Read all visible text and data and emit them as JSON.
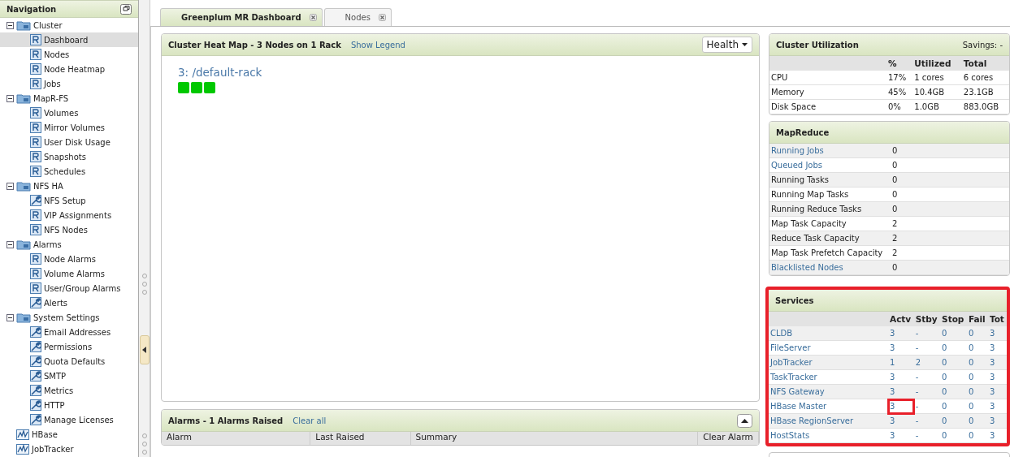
{
  "navigation": {
    "title": "Navigation",
    "groups": [
      {
        "label": "Cluster",
        "expanded": true,
        "children": [
          {
            "label": "Dashboard",
            "kind": "report",
            "selected": true
          },
          {
            "label": "Nodes",
            "kind": "report",
            "selected": false
          },
          {
            "label": "Node Heatmap",
            "kind": "report",
            "selected": false
          },
          {
            "label": "Jobs",
            "kind": "report",
            "selected": false
          }
        ]
      },
      {
        "label": "MapR-FS",
        "expanded": true,
        "children": [
          {
            "label": "Volumes",
            "kind": "report",
            "selected": false
          },
          {
            "label": "Mirror Volumes",
            "kind": "report",
            "selected": false
          },
          {
            "label": "User Disk Usage",
            "kind": "report",
            "selected": false
          },
          {
            "label": "Snapshots",
            "kind": "report",
            "selected": false
          },
          {
            "label": "Schedules",
            "kind": "report",
            "selected": false
          }
        ]
      },
      {
        "label": "NFS HA",
        "expanded": true,
        "children": [
          {
            "label": "NFS Setup",
            "kind": "tool",
            "selected": false
          },
          {
            "label": "VIP Assignments",
            "kind": "report",
            "selected": false
          },
          {
            "label": "NFS Nodes",
            "kind": "report",
            "selected": false
          }
        ]
      },
      {
        "label": "Alarms",
        "expanded": true,
        "children": [
          {
            "label": "Node Alarms",
            "kind": "report",
            "selected": false
          },
          {
            "label": "Volume Alarms",
            "kind": "report",
            "selected": false
          },
          {
            "label": "User/Group Alarms",
            "kind": "report",
            "selected": false
          },
          {
            "label": "Alerts",
            "kind": "tool",
            "selected": false
          }
        ]
      },
      {
        "label": "System Settings",
        "expanded": true,
        "children": [
          {
            "label": "Email Addresses",
            "kind": "tool",
            "selected": false
          },
          {
            "label": "Permissions",
            "kind": "tool",
            "selected": false
          },
          {
            "label": "Quota Defaults",
            "kind": "tool",
            "selected": false
          },
          {
            "label": "SMTP",
            "kind": "tool",
            "selected": false
          },
          {
            "label": "Metrics",
            "kind": "tool",
            "selected": false
          },
          {
            "label": "HTTP",
            "kind": "tool",
            "selected": false
          },
          {
            "label": "Manage Licenses",
            "kind": "tool",
            "selected": false
          }
        ]
      }
    ],
    "links": [
      {
        "label": "HBase"
      },
      {
        "label": "JobTracker"
      }
    ]
  },
  "tabs": [
    {
      "label": "Greenplum MR Dashboard",
      "selected": true
    },
    {
      "label": "Nodes",
      "selected": false
    }
  ],
  "heatmap": {
    "title": "Cluster Heat Map - 3 Nodes on 1 Rack",
    "legend_link": "Show Legend",
    "dropdown": "Health",
    "rack": "3: /default-rack",
    "nodes": [
      {
        "color": "#00c800"
      },
      {
        "color": "#00c800"
      },
      {
        "color": "#00c800"
      }
    ]
  },
  "alarms": {
    "title": "Alarms - 1 Alarms Raised",
    "clear_link": "Clear all",
    "columns": [
      "Alarm",
      "Last Raised",
      "Summary",
      "Clear Alarm"
    ]
  },
  "utilization": {
    "title": "Cluster Utilization",
    "savings": "Savings: -",
    "columns": [
      "%",
      "Utilized",
      "Total"
    ],
    "rows": [
      {
        "name": "CPU",
        "cells": [
          "17%",
          "1 cores",
          "6 cores"
        ]
      },
      {
        "name": "Memory",
        "cells": [
          "45%",
          "10.4GB",
          "23.1GB"
        ]
      },
      {
        "name": "Disk Space",
        "cells": [
          "0%",
          "1.0GB",
          "883.0GB"
        ]
      }
    ]
  },
  "mapreduce": {
    "title": "MapReduce",
    "rows": [
      {
        "name": "Running Jobs",
        "value": "0",
        "link": true
      },
      {
        "name": "Queued Jobs",
        "value": "0",
        "link": true
      },
      {
        "name": "Running Tasks",
        "value": "0",
        "link": false
      },
      {
        "name": "Running Map Tasks",
        "value": "0",
        "link": false
      },
      {
        "name": "Running Reduce Tasks",
        "value": "0",
        "link": false
      },
      {
        "name": "Map Task Capacity",
        "value": "2",
        "link": false
      },
      {
        "name": "Reduce Task Capacity",
        "value": "2",
        "link": false
      },
      {
        "name": "Map Task Prefetch Capacity",
        "value": "2",
        "link": false
      },
      {
        "name": "Blacklisted Nodes",
        "value": "0",
        "link": true
      }
    ]
  },
  "services": {
    "title": "Services",
    "highlighted": true,
    "columns": [
      "Actv",
      "Stby",
      "Stop",
      "Fail",
      "Tot"
    ],
    "rows": [
      {
        "name": "CLDB",
        "cells": [
          "3",
          "-",
          "0",
          "0",
          "3"
        ],
        "highlighted": false
      },
      {
        "name": "FileServer",
        "cells": [
          "3",
          "-",
          "0",
          "0",
          "3"
        ],
        "highlighted": false
      },
      {
        "name": "JobTracker",
        "cells": [
          "1",
          "2",
          "0",
          "0",
          "3"
        ],
        "highlighted": false
      },
      {
        "name": "TaskTracker",
        "cells": [
          "3",
          "-",
          "0",
          "0",
          "3"
        ],
        "highlighted": false
      },
      {
        "name": "NFS Gateway",
        "cells": [
          "3",
          "-",
          "0",
          "0",
          "3"
        ],
        "highlighted": false
      },
      {
        "name": "HBase Master",
        "cells": [
          "3",
          "-",
          "0",
          "0",
          "3"
        ],
        "highlighted": true
      },
      {
        "name": "HBase RegionServer",
        "cells": [
          "3",
          "-",
          "0",
          "0",
          "3"
        ],
        "highlighted": false
      },
      {
        "name": "HostStats",
        "cells": [
          "3",
          "-",
          "0",
          "0",
          "3"
        ],
        "highlighted": false
      }
    ]
  }
}
